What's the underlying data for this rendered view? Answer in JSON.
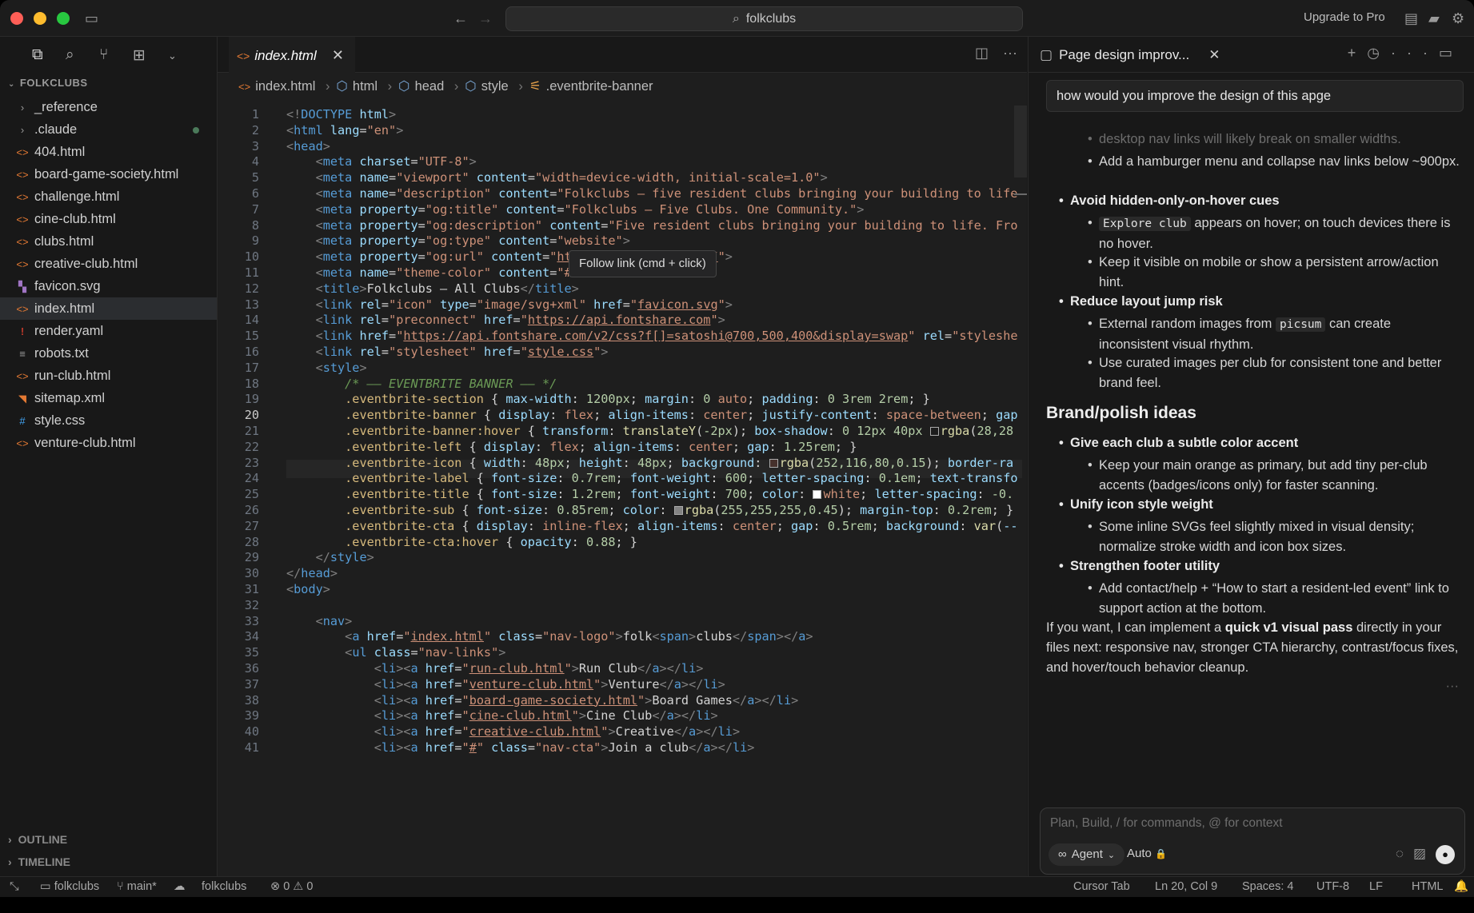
{
  "titlebar": {
    "search": "folkclubs",
    "upgrade": "Upgrade to Pro"
  },
  "sidebar": {
    "section": "FOLKCLUBS",
    "files": [
      {
        "name": "_reference",
        "kind": "folder"
      },
      {
        "name": ".claude",
        "kind": "folder"
      },
      {
        "name": "404.html",
        "kind": "html"
      },
      {
        "name": "board-game-society.html",
        "kind": "html"
      },
      {
        "name": "challenge.html",
        "kind": "html"
      },
      {
        "name": "cine-club.html",
        "kind": "html"
      },
      {
        "name": "clubs.html",
        "kind": "html"
      },
      {
        "name": "creative-club.html",
        "kind": "html"
      },
      {
        "name": "favicon.svg",
        "kind": "svg"
      },
      {
        "name": "index.html",
        "kind": "html"
      },
      {
        "name": "render.yaml",
        "kind": "yaml"
      },
      {
        "name": "robots.txt",
        "kind": "txt"
      },
      {
        "name": "run-club.html",
        "kind": "html"
      },
      {
        "name": "sitemap.xml",
        "kind": "xml"
      },
      {
        "name": "style.css",
        "kind": "css"
      },
      {
        "name": "venture-club.html",
        "kind": "html"
      }
    ],
    "outline": "OUTLINE",
    "timeline": "TIMELINE"
  },
  "editor": {
    "tab": "index.html",
    "breadcrumb": [
      "index.html",
      "html",
      "head",
      "style",
      ".eventbrite-banner"
    ],
    "tooltip_link": "Follow link",
    "tooltip_hint": "(cmd + click)",
    "line_numbers": [
      "1",
      "2",
      "3",
      "4",
      "5",
      "6",
      "7",
      "8",
      "9",
      "10",
      "11",
      "12",
      "13",
      "14",
      "15",
      "16",
      "17",
      "18",
      "19",
      "20",
      "21",
      "22",
      "23",
      "24",
      "25",
      "26",
      "27",
      "28",
      "29",
      "30",
      "31",
      "32",
      "33",
      "34",
      "35",
      "36",
      "37",
      "38",
      "39",
      "40",
      "41"
    ]
  },
  "chat": {
    "tab": "Page design improv...",
    "user_message": "how would you improve the design of this apge",
    "faded_line": "desktop nav links will likely break on smaller widths.",
    "items": {
      "hamburger": "Add a hamburger menu and collapse nav links below ~900px.",
      "hover_title": "Avoid hidden-only-on-hover cues",
      "hover_code": "Explore club",
      "hover_text": "appears on hover; on touch devices there is no hover.",
      "hover_keep": "Keep it visible on mobile or show a persistent arrow/action hint.",
      "layout_title": "Reduce layout jump risk",
      "layout_pre": "External random images from",
      "layout_code": "picsum",
      "layout_post": "can create inconsistent visual rhythm.",
      "layout_curated": "Use curated images per club for consistent tone and better brand feel.",
      "brand_heading": "Brand/polish ideas",
      "accent_title": "Give each club a subtle color accent",
      "accent_text": "Keep your main orange as primary, but add tiny per-club accents (badges/icons only) for faster scanning.",
      "icon_title": "Unify icon style weight",
      "icon_text": "Some inline SVGs feel slightly mixed in visual density; normalize stroke width and icon box sizes.",
      "footer_title": "Strengthen footer utility",
      "footer_text": "Add contact/help + “How to start a resident-led event” link to support action at the bottom.",
      "closing_pre": "If you want, I can implement a",
      "closing_bold": "quick v1 visual pass",
      "closing_post": "directly in your files next: responsive nav, stronger CTA hierarchy, contrast/focus fixes, and hover/touch behavior cleanup."
    },
    "composer_placeholder": "Plan, Build, / for commands, @ for context",
    "agent": "Agent",
    "auto": "Auto"
  },
  "statusbar": {
    "workspace": "folkclubs",
    "branch": "main*",
    "project": "folkclubs",
    "errors": "0",
    "warnings": "0",
    "cursor_tab": "Cursor Tab",
    "position": "Ln 20, Col 9",
    "spaces": "Spaces: 4",
    "encoding": "UTF-8",
    "eol": "LF",
    "language": "HTML"
  }
}
